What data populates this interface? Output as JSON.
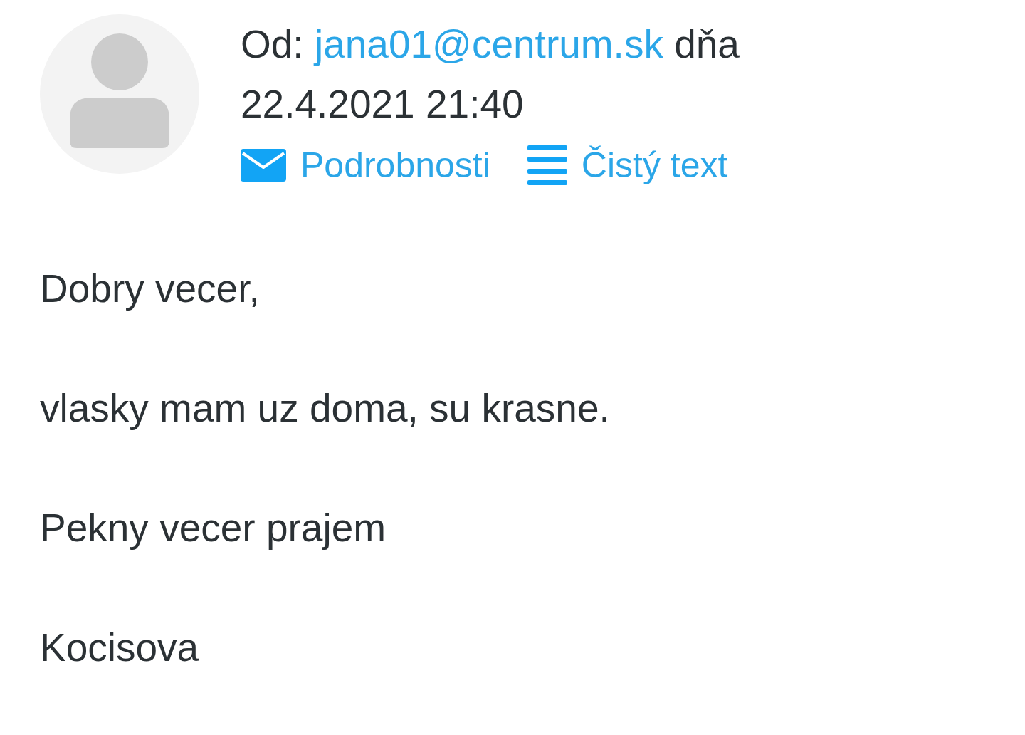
{
  "message_header": {
    "sender_line": {
      "from_label": "Od:",
      "email": "jana01@centrum.sk",
      "date_prefix": "dňa",
      "date": "22.4.2021 21:40"
    },
    "actions": [
      {
        "kind": "details",
        "label": "Podrobnosti"
      },
      {
        "kind": "plain_text",
        "label": "Čistý text"
      }
    ]
  },
  "body": {
    "paragraphs": [
      "Dobry vecer,",
      "vlasky mam uz doma, su krasne.",
      "Pekny vecer prajem",
      "Kocisova"
    ]
  }
}
